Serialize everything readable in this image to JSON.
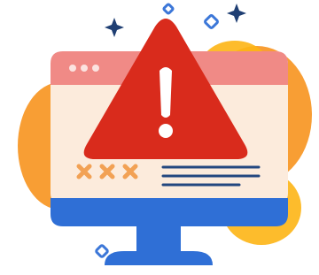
{
  "illustration": {
    "subject": "computer-monitor-with-warning-alert",
    "icons": [
      "warning-triangle-icon",
      "exclamation-mark-icon",
      "window-dots-icon",
      "error-x-marks-icon",
      "text-lines-icon",
      "sparkle-icon"
    ]
  },
  "colors": {
    "blob_orange": "#F7931E",
    "blob_yellow": "#FDB515",
    "window_body": "#FCEBDC",
    "title_bar": "#F08A86",
    "title_dots": "#FBE3E0",
    "warning_red": "#D92B1C",
    "exclamation": "#FFFFFF",
    "x_marks": "#F2A154",
    "text_lines": "#23477F",
    "monitor_base_bar": "#2F6FD6",
    "stand": "#2F6FD6",
    "sparkle_navy": "#1F3F73",
    "sparkle_blue": "#3C77D8"
  }
}
